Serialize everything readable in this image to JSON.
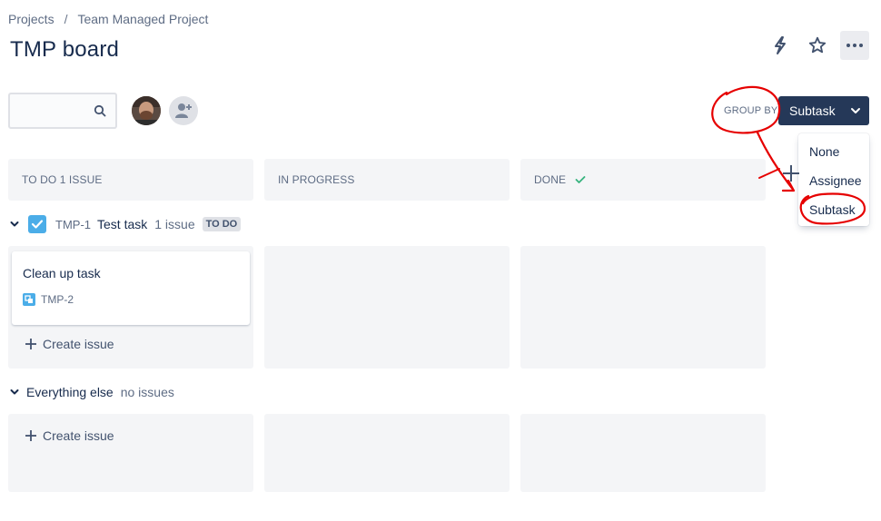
{
  "breadcrumb": {
    "items": [
      "Projects",
      "Team Managed Project"
    ],
    "separator": "/"
  },
  "page": {
    "title": "TMP board"
  },
  "search": {
    "value": "",
    "placeholder": ""
  },
  "group_by": {
    "label": "GROUP BY",
    "selected": "Subtask",
    "options": [
      "None",
      "Assignee",
      "Subtask"
    ]
  },
  "columns": [
    {
      "title": "TO DO 1 ISSUE"
    },
    {
      "title": "IN PROGRESS"
    },
    {
      "title": "DONE"
    }
  ],
  "swimlanes": [
    {
      "key": "TMP-1",
      "title": "Test task",
      "count": "1 issue",
      "status": "TO DO"
    },
    {
      "title": "Everything else",
      "count": "no issues"
    }
  ],
  "card": {
    "title": "Clean up task",
    "key": "TMP-2"
  },
  "create_label": "Create issue",
  "colors": {
    "header_bg": "#f4f5f7",
    "button_dark": "#253858",
    "accent_blue": "#4bade8",
    "done_green": "#36b37e",
    "annotation_red": "#e60000"
  }
}
